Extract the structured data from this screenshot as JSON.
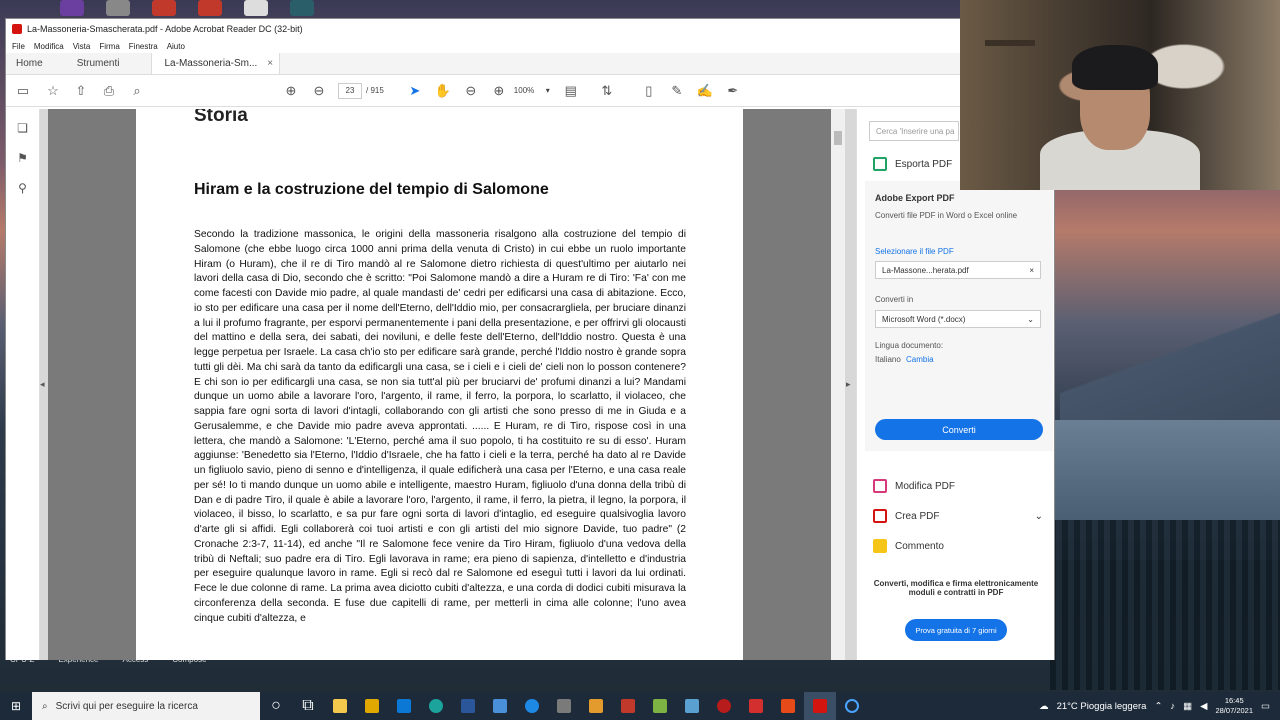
{
  "window": {
    "title": "La-Massoneria-Smascherata.pdf - Adobe Acrobat Reader DC (32-bit)",
    "menu": [
      "File",
      "Modifica",
      "Vista",
      "Firma",
      "Finestra",
      "Aiuto"
    ]
  },
  "tabs": {
    "home": "Home",
    "tools": "Strumenti",
    "doc": "La-Massoneria-Sm..."
  },
  "toolbar": {
    "page_current": "23",
    "page_total": "/ 915",
    "zoom": "100%"
  },
  "document": {
    "section": "Storia",
    "heading": "Hiram e la costruzione del tempio di Salomone",
    "paragraph": "Secondo la tradizione massonica, le origini della massoneria risalgono alla costruzione del tempio di Salomone (che ebbe luogo circa 1000 anni prima della venuta di Cristo) in cui ebbe un ruolo importante Hiram (o Huram), che il re di Tiro mandò al re Salomone dietro richiesta di quest'ultimo per aiutarlo nei lavori della casa di Dio, secondo che è scritto: \"Poi Salomone mandò a dire a Huram re di Tiro: 'Fa' con me come facesti con Davide mio padre, al quale mandasti de' cedri per edificarsi una casa di abitazione. Ecco, io sto per edificare una casa per il nome dell'Eterno, dell'Iddio mio, per consacrargliela, per bruciare dinanzi a lui il profumo fragrante, per esporvi permanentemente i pani della presentazione, e per offrirvi gli olocausti del mattino e della sera, dei sabati, dei noviluni, e delle feste dell'Eterno, dell'Iddio nostro. Questa è una legge perpetua per Israele. La casa ch'io sto per edificare sarà grande, perché l'Iddio nostro è grande sopra tutti gli dèi. Ma chi sarà da tanto da edificargli una casa, se i cieli e i cieli de' cieli non lo posson contenere? E chi son io per edificargli una casa, se non sia tutt'al più per bruciarvi de' profumi dinanzi a lui? Mandami dunque un uomo abile a lavorare l'oro, l'argento, il rame, il ferro, la porpora, lo scarlatto, il violaceo, che sappia fare ogni sorta di lavori d'intagli, collaborando con gli artisti che sono presso di me in Giuda e a Gerusalemme, e che Davide mio padre aveva approntati. ...... E Huram, re di Tiro, rispose così in una lettera, che mandò a Salomone: 'L'Eterno, perché ama il suo popolo, ti ha costituito re su di esso'. Huram aggiunse: 'Benedetto sia l'Eterno, l'Iddio d'Israele, che ha fatto i cieli e la terra, perché ha dato al re Davide un figliuolo savio, pieno di senno e d'intelligenza, il quale edificherà una casa per l'Eterno, e una casa reale per sé! Io ti mando dunque un uomo abile e intelligente, maestro Huram, figliuolo d'una donna della tribù di Dan e di padre Tiro, il quale è abile a lavorare l'oro, l'argento, il rame, il ferro, la pietra, il legno, la porpora, il violaceo, il bisso, lo scarlatto, e sa pur fare ogni sorta di lavori d'intaglio, ed eseguire qualsivoglia lavoro d'arte gli si affidi. Egli collaborerà coi tuoi artisti e con gli artisti del mio signore Davide, tuo padre\" (2 Cronache 2:3-7, 11-14), ed anche \"Il re Salomone fece venire da Tiro Hiram, figliuolo d'una vedova della tribù di Neftali; suo padre era di Tiro. Egli lavorava in rame; era pieno di sapienza, d'intelletto e d'industria per eseguire qualunque lavoro in rame. Egli si recò dal re Salomone ed eseguì tutti i lavori da lui ordinati. Fece le due colonne di rame. La prima avea diciotto cubiti d'altezza, e una corda di dodici cubiti misurava la circonferenza della seconda. E fuse due capitelli di rame, per metterli in cima alle colonne; l'uno avea cinque cubiti d'altezza, e"
  },
  "right_panel": {
    "search_placeholder": "Cerca 'Inserire una pa",
    "export_pdf": "Esporta PDF",
    "export_title": "Adobe Export PDF",
    "export_desc": "Converti file PDF in Word o Excel online",
    "select_file_label": "Selezionare il file PDF",
    "selected_file": "La-Massone...herata.pdf",
    "convert_to_label": "Converti in",
    "convert_format": "Microsoft Word (*.docx)",
    "language_label": "Lingua documento:",
    "language_value": "Italiano",
    "language_change": "Cambia",
    "convert_button": "Converti",
    "tools": [
      "Modifica PDF",
      "Crea PDF",
      "Commento"
    ],
    "promo": "Converti, modifica e firma elettronicamente moduli e contratti in PDF",
    "trial_button": "Prova gratuita di 7 giorni"
  },
  "taskbar": {
    "search_placeholder": "Scrivi qui per eseguire la ricerca",
    "weather": "21°C  Pioggia leggera",
    "time": "16:45",
    "date": "28/07/2021"
  },
  "desktop_labels": [
    "CPU-Z",
    "Experience",
    "Access",
    "Compose"
  ],
  "colors": {
    "accent": "#1473e6",
    "acrobat_red": "#d4140e"
  }
}
